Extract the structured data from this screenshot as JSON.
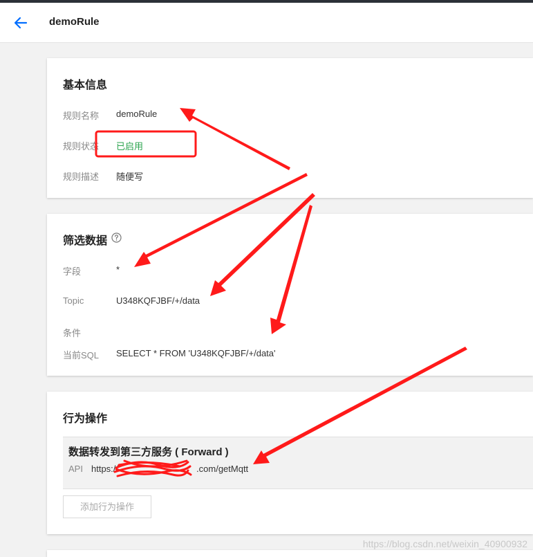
{
  "header": {
    "title": "demoRule"
  },
  "basic": {
    "title": "基本信息",
    "rows": [
      {
        "label": "规则名称",
        "value": "demoRule"
      },
      {
        "label": "规则状态",
        "value": "已启用"
      },
      {
        "label": "规则描述",
        "value": "随便写"
      }
    ]
  },
  "filter": {
    "title": "筛选数据",
    "rows": [
      {
        "label": "字段",
        "value": "*"
      },
      {
        "label": "Topic",
        "value": "U348KQFJBF/+/data"
      },
      {
        "label": "条件",
        "value": ""
      },
      {
        "label": "当前SQL",
        "value": "SELECT * FROM 'U348KQFJBF/+/data'"
      }
    ]
  },
  "actions": {
    "title": "行为操作",
    "item_title": "数据转发到第三方服务 ( Forward )",
    "api_label": "API",
    "api_value_prefix": "https://",
    "api_value_suffix": ".com/getMqtt",
    "add_button": "添加行为操作"
  },
  "watermark": "https://blog.csdn.net/weixin_40900932",
  "colors": {
    "accent": "#006eff",
    "status_green": "#2aa34d",
    "annotation_red": "#ff1a1a"
  }
}
